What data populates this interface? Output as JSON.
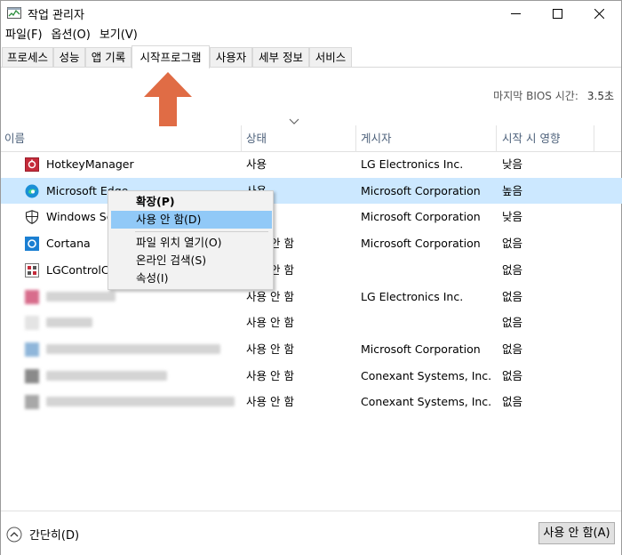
{
  "window": {
    "title": "작업 관리자"
  },
  "menu": [
    "파일(F)",
    "옵션(O)",
    "보기(V)"
  ],
  "tabs": [
    "프로세스",
    "성능",
    "앱 기록",
    "시작프로그램",
    "사용자",
    "세부 정보",
    "서비스"
  ],
  "active_tab": "시작프로그램",
  "bios": {
    "label": "마지막 BIOS 시간:",
    "value": "3.5초"
  },
  "columns": [
    "이름",
    "상태",
    "게시자",
    "시작 시 영향"
  ],
  "rows": [
    {
      "name": "HotkeyManager",
      "status": "사용",
      "publisher": "LG Electronics Inc.",
      "impact": "낮음",
      "icon": "hotkey-icon"
    },
    {
      "name": "Microsoft Edge",
      "status": "사용",
      "publisher": "Microsoft Corporation",
      "impact": "높음",
      "icon": "edge-icon"
    },
    {
      "name": "Windows Se",
      "status": "",
      "publisher": "Microsoft Corporation",
      "impact": "낮음",
      "icon": "shield-icon"
    },
    {
      "name": "Cortana",
      "status": "사용 안 함",
      "publisher": "Microsoft Corporation",
      "impact": "없음",
      "icon": "cortana-icon"
    },
    {
      "name": "LGControlCe",
      "status": "사용 안 함",
      "publisher": "",
      "impact": "없음",
      "icon": "lgcontrol-icon"
    },
    {
      "name": "",
      "status": "사용 안 함",
      "publisher": "LG Electronics Inc.",
      "impact": "없음",
      "icon": "blurred-icon"
    },
    {
      "name": "",
      "status": "사용 안 함",
      "publisher": "",
      "impact": "없음",
      "icon": "blurred-icon"
    },
    {
      "name": "",
      "status": "사용 안 함",
      "publisher": "Microsoft Corporation",
      "impact": "없음",
      "icon": "blurred-icon"
    },
    {
      "name": "",
      "status": "사용 안 함",
      "publisher": "Conexant Systems, Inc.",
      "impact": "없음",
      "icon": "blurred-icon"
    },
    {
      "name": "",
      "status": "사용 안 함",
      "publisher": "Conexant Systems, Inc.",
      "impact": "없음",
      "icon": "blurred-icon"
    }
  ],
  "context_menu": {
    "expand": "확장(P)",
    "disable": "사용 안 함(D)",
    "open_location": "파일 위치 열기(O)",
    "search_online": "온라인 검색(S)",
    "properties": "속성(I)"
  },
  "footer": {
    "fewer_details": "간단히(D)",
    "disable_button": "사용 안 함(A)"
  },
  "colors": {
    "selected_row": "#cce8ff",
    "menu_highlight": "#91c9f7",
    "arrow": "#e06c45",
    "header_text": "#4c607a"
  }
}
